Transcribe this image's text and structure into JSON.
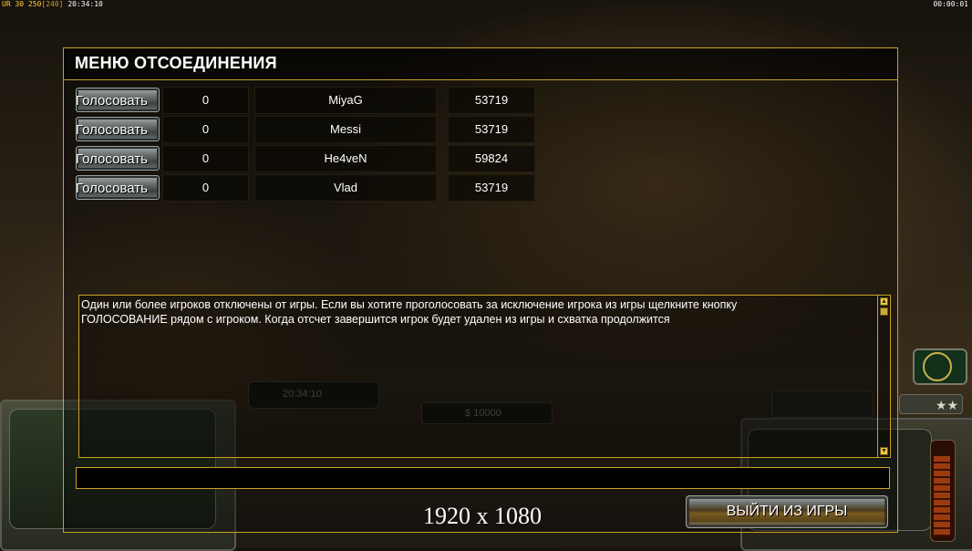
{
  "hud": {
    "stats_prefix": "UR",
    "fps": "30",
    "logic": "250",
    "logic_bracket": "[240]",
    "clock": "20:34:10",
    "timer": "00:00:01"
  },
  "background_hud": {
    "clock": "20:34:10",
    "money": "$ 10000",
    "stars": "★★"
  },
  "dialog": {
    "title": "МЕНЮ ОТСОЕДИНЕНИЯ",
    "vote_label": "Голосовать",
    "players": [
      {
        "votes": "0",
        "name": "MiyaG",
        "ping": "53719"
      },
      {
        "votes": "0",
        "name": "Messi",
        "ping": "53719"
      },
      {
        "votes": "0",
        "name": "He4veN",
        "ping": "59824"
      },
      {
        "votes": "0",
        "name": "Vlad",
        "ping": "53719"
      }
    ],
    "message": "Один или более игроков отключены от игры. Если вы хотите проголосовать за исключение игрока из игры щелкните кнопку\n ГОЛОСОВАНИЕ рядом с игроком. Когда отсчет завершится игрок будет удален из игры и схватка продолжится",
    "chat_value": "",
    "quit_label": "ВЫЙТИ ИЗ ИГРЫ"
  },
  "overlay": {
    "resolution": "1920 x 1080"
  }
}
